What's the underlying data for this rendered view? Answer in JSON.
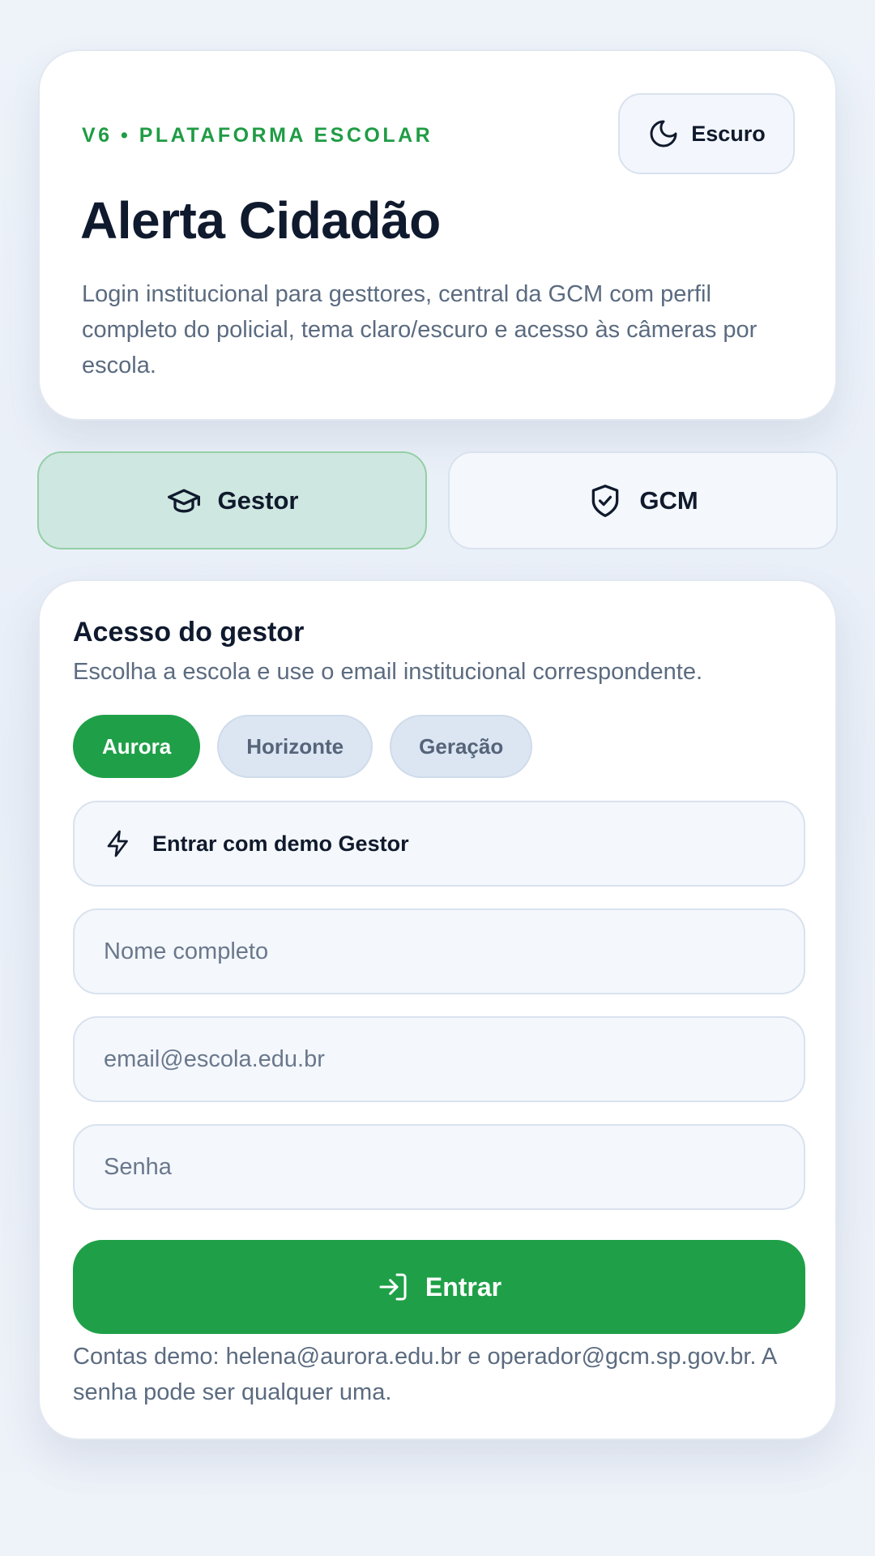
{
  "header": {
    "eyebrow": "V6 • PLATAFORMA ESCOLAR",
    "title": "Alerta Cidadão",
    "description": "Login institucional para gesttores, central da GCM com perfil completo do policial, tema claro/escuro e acesso às câmeras por escola.",
    "theme_toggle": {
      "label": "Escuro",
      "icon": "moon-icon"
    }
  },
  "roles": [
    {
      "label": "Gestor",
      "icon": "graduation-cap-icon",
      "active": true
    },
    {
      "label": "GCM",
      "icon": "shield-check-icon",
      "active": false
    }
  ],
  "form": {
    "title": "Acesso do gestor",
    "subtitle": "Escolha a escola e use o email institucional correspondente.",
    "schools": [
      {
        "label": "Aurora",
        "active": true
      },
      {
        "label": "Horizonte",
        "active": false
      },
      {
        "label": "Geração",
        "active": false
      }
    ],
    "demo_button": {
      "label": "Entrar com demo Gestor",
      "icon": "lightning-icon"
    },
    "fields": {
      "name": {
        "placeholder": "Nome completo",
        "value": ""
      },
      "email": {
        "placeholder": "email@escola.edu.br",
        "value": ""
      },
      "password": {
        "placeholder": "Senha",
        "value": ""
      }
    },
    "submit": {
      "label": "Entrar",
      "icon": "login-icon"
    },
    "footnote": "Contas demo: helena@aurora.edu.br e operador@gcm.sp.gov.br. A senha pode ser qualquer uma."
  },
  "colors": {
    "accent": "#1fa048",
    "active_tab_bg": "#cfe7e1",
    "text_dark": "#0f1a2e",
    "text_muted": "#5b6b80",
    "background": "#eef3fa"
  }
}
